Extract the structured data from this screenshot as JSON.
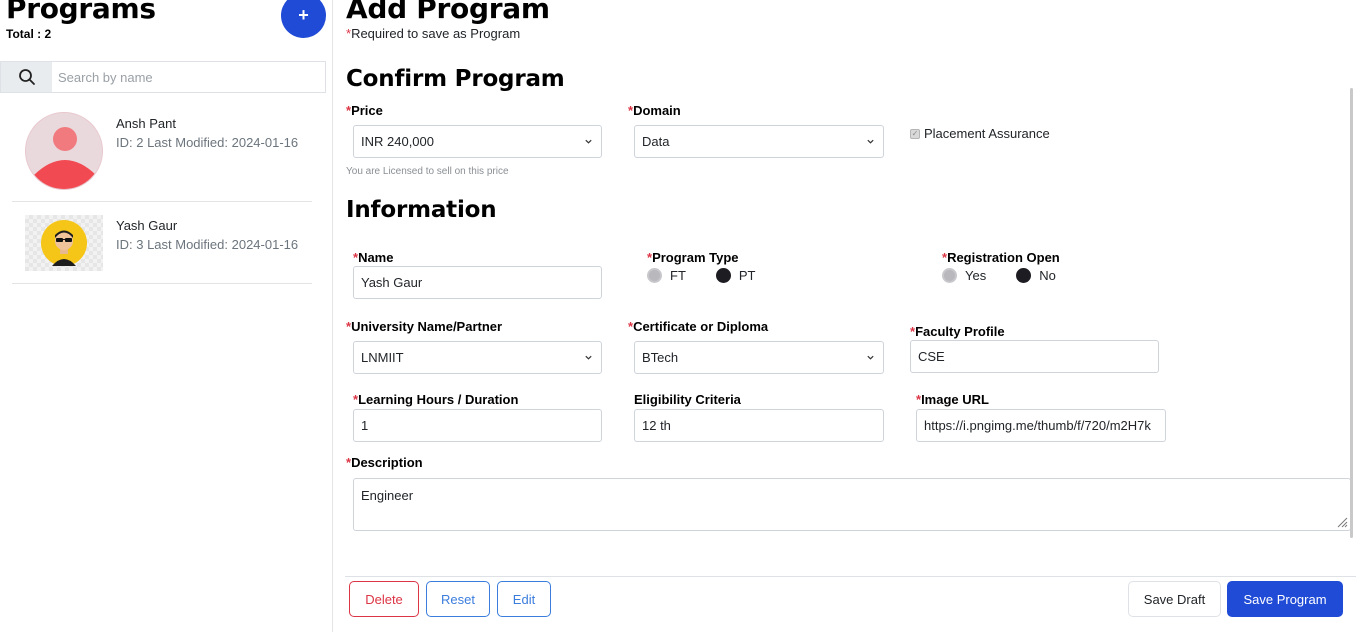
{
  "sidebar": {
    "title": "Programs",
    "total_label": "Total : 2",
    "add_button": "+",
    "search": {
      "placeholder": "Search by name",
      "value": ""
    },
    "programs": [
      {
        "name": "Ansh Pant",
        "meta": "ID: 2 Last Modified: 2024-01-16"
      },
      {
        "name": "Yash Gaur",
        "meta": "ID: 3 Last Modified: 2024-01-16"
      }
    ]
  },
  "main": {
    "title": "Add Program",
    "required_note_star": "*",
    "required_note": "Required to save as Program",
    "confirm": {
      "title": "Confirm Program",
      "price": {
        "label": "Price",
        "value": "INR 240,000",
        "hint": "You are Licensed to sell on this price"
      },
      "domain": {
        "label": "Domain",
        "value": "Data"
      },
      "placement_assurance": {
        "label": "Placement Assurance",
        "checked": true
      }
    },
    "information": {
      "title": "Information",
      "name": {
        "label": "Name",
        "value": "Yash Gaur"
      },
      "program_type": {
        "label": "Program Type",
        "options": [
          "FT",
          "PT"
        ],
        "selected": "PT"
      },
      "registration_open": {
        "label": "Registration Open",
        "options": [
          "Yes",
          "No"
        ],
        "selected": "No"
      },
      "university": {
        "label": "University Name/Partner",
        "value": "LNMIIT"
      },
      "certificate": {
        "label": "Certificate or Diploma",
        "value": "BTech"
      },
      "faculty": {
        "label": "Faculty Profile",
        "value": "CSE"
      },
      "learning_hours": {
        "label": "Learning Hours / Duration",
        "value": "1"
      },
      "eligibility": {
        "label": "Eligibility Criteria",
        "value": "12 th"
      },
      "image_url": {
        "label": "Image URL",
        "value": "https://i.pngimg.me/thumb/f/720/m2H7k"
      },
      "description": {
        "label": "Description",
        "value": "Engineer"
      }
    },
    "buttons": {
      "delete": "Delete",
      "reset": "Reset",
      "edit": "Edit",
      "save_draft": "Save Draft",
      "save_program": "Save Program"
    }
  },
  "colors": {
    "primary": "#1f4bd6",
    "danger": "#dc3545",
    "outline_blue": "#3b7ddd",
    "required_star": "#dc3545"
  },
  "icons": [
    "search-icon",
    "chevron-down-icon",
    "user-avatar-icon",
    "sunglasses-avatar-icon",
    "resize-grip-icon",
    "check-icon"
  ]
}
